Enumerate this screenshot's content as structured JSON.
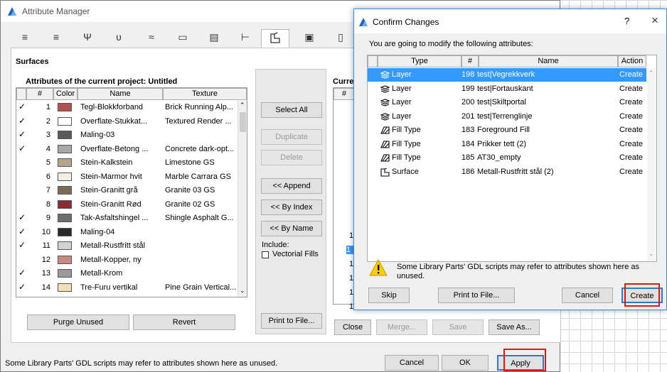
{
  "attribute_manager": {
    "title": "Attribute Manager",
    "section_title": "Surfaces",
    "project_label": "Attributes of the current project: Untitled",
    "current_label": "Curre",
    "columns": [
      "#",
      "Color",
      "Name",
      "Texture"
    ],
    "rows": [
      {
        "check": "✓",
        "num": "1",
        "color": "#b0524d",
        "name": "Tegl-Blokkforband",
        "texture": "Brick Running Alp..."
      },
      {
        "check": "✓",
        "num": "2",
        "color": "#ffffff",
        "name": "Overflate-Stukkat...",
        "texture": "Textured Render ..."
      },
      {
        "check": "✓",
        "num": "3",
        "color": "#5a5a5a",
        "name": "Maling-03",
        "texture": ""
      },
      {
        "check": "✓",
        "num": "4",
        "color": "#a8a8a8",
        "name": "Overflate-Betong ...",
        "texture": "Concrete dark-opt..."
      },
      {
        "check": "",
        "num": "5",
        "color": "#b6a58d",
        "name": "Stein-Kalkstein",
        "texture": "Limestone GS"
      },
      {
        "check": "",
        "num": "6",
        "color": "#f3eee2",
        "name": "Stein-Marmor hvit",
        "texture": "Marble Carrara GS"
      },
      {
        "check": "",
        "num": "7",
        "color": "#7a6a55",
        "name": "Stein-Granitt grå",
        "texture": "Granite 03 GS"
      },
      {
        "check": "",
        "num": "8",
        "color": "#8d2b35",
        "name": "Stein-Granitt Rød",
        "texture": "Granite 02 GS"
      },
      {
        "check": "✓",
        "num": "9",
        "color": "#6e6e6e",
        "name": "Tak-Asfaltshingel ...",
        "texture": "Shingle Asphalt G..."
      },
      {
        "check": "✓",
        "num": "10",
        "color": "#2a2a2a",
        "name": "Maling-04",
        "texture": ""
      },
      {
        "check": "✓",
        "num": "11",
        "color": "#d2d2d2",
        "name": "Metall-Rustfritt stål",
        "texture": ""
      },
      {
        "check": "",
        "num": "12",
        "color": "#c78a80",
        "name": "Metall-Kopper, ny",
        "texture": ""
      },
      {
        "check": "✓",
        "num": "13",
        "color": "#9a9a9a",
        "name": "Metall-Krom",
        "texture": ""
      },
      {
        "check": "✓",
        "num": "14",
        "color": "#f2dfb8",
        "name": "Tre-Furu vertikal",
        "texture": "Pine Grain Vertical..."
      }
    ],
    "right_nums": [
      "1",
      "1",
      "1",
      "1",
      "1",
      "1"
    ],
    "buttons": {
      "select_all": "Select All",
      "duplicate": "Duplicate",
      "delete": "Delete",
      "append": "<< Append",
      "by_index": "<< By Index",
      "by_name": "<< By Name",
      "purge_unused": "Purge Unused",
      "revert": "Revert",
      "print_to_file": "Print to File...",
      "close": "Close",
      "merge": "Merge...",
      "save": "Save",
      "save_as": "Save As...",
      "cancel": "Cancel",
      "ok": "OK",
      "apply": "Apply"
    },
    "include_label": "Include:",
    "vectorial_fills": "Vectorial Fills",
    "footer_text": "Some Library Parts' GDL scripts may refer to attributes shown here as unused."
  },
  "confirm_dialog": {
    "title": "Confirm Changes",
    "help": "?",
    "close": "×",
    "intro": "You are going to modify the following attributes:",
    "columns": [
      "Type",
      "#",
      "Name",
      "Action"
    ],
    "rows": [
      {
        "icon": "layer-icon",
        "type": "Layer",
        "num": "198",
        "name": "test|Vegrekkverk",
        "action": "Create",
        "selected": true
      },
      {
        "icon": "layer-icon",
        "type": "Layer",
        "num": "199",
        "name": "test|Fortauskant",
        "action": "Create",
        "selected": false
      },
      {
        "icon": "layer-icon",
        "type": "Layer",
        "num": "200",
        "name": "test|Skiltportal",
        "action": "Create",
        "selected": false
      },
      {
        "icon": "layer-icon",
        "type": "Layer",
        "num": "201",
        "name": "test|Terrenglinje",
        "action": "Create",
        "selected": false
      },
      {
        "icon": "fill-type-icon",
        "type": "Fill Type",
        "num": "183",
        "name": "Foreground Fill",
        "action": "Create",
        "selected": false
      },
      {
        "icon": "fill-type-icon",
        "type": "Fill Type",
        "num": "184",
        "name": "Prikker tett (2)",
        "action": "Create",
        "selected": false
      },
      {
        "icon": "fill-type-icon",
        "type": "Fill Type",
        "num": "185",
        "name": "AT30_empty",
        "action": "Create",
        "selected": false
      },
      {
        "icon": "surface-icon",
        "type": "Surface",
        "num": "186",
        "name": "Metall-Rustfritt stål (2)",
        "action": "Create",
        "selected": false
      }
    ],
    "warning": "Some Library Parts' GDL scripts may refer to attributes shown here as unused.",
    "buttons": {
      "skip": "Skip",
      "print_to_file": "Print to File...",
      "cancel": "Cancel",
      "create": "Create"
    }
  },
  "colors": {
    "selection": "#3399ff",
    "dialog_border": "#3b8de0",
    "highlight_box": "#e51515",
    "app_icon": "#1f5fbf"
  }
}
